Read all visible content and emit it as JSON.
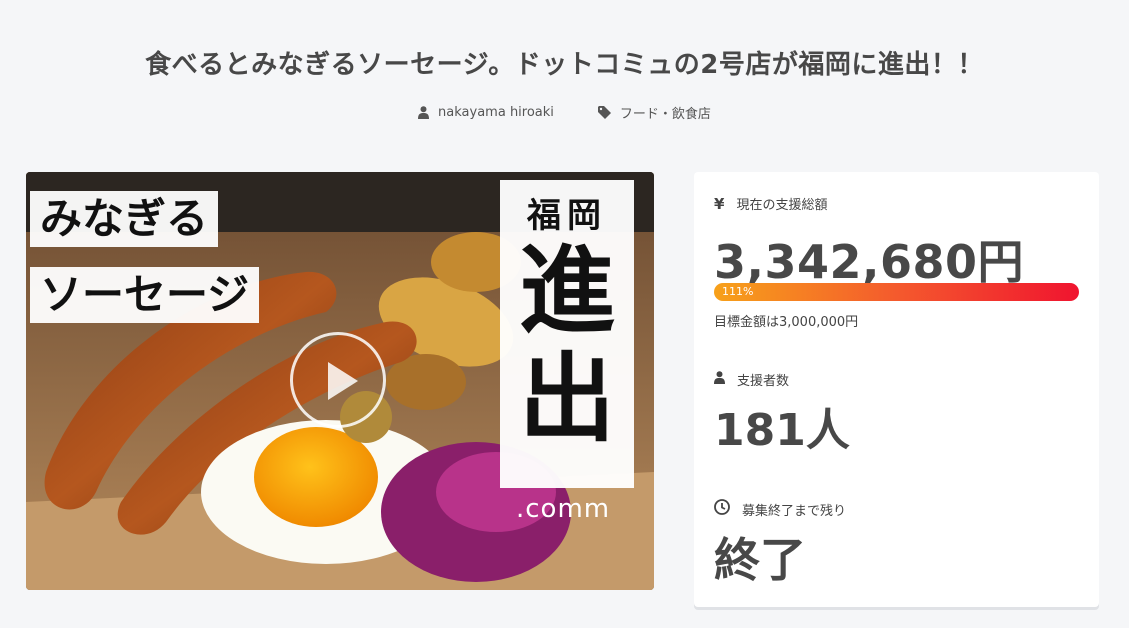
{
  "project": {
    "title": "食べるとみなぎるソーセージ。ドットコミュの2号店が福岡に進出！！",
    "author": "nakayama hiroaki",
    "category": "フード・飲食店"
  },
  "video": {
    "caption_line1": "みなぎる",
    "caption_line2": "ソーセージ",
    "vertical_small": "福岡",
    "vertical_big1": "進",
    "vertical_big2": "出",
    "brand": ".comm"
  },
  "stats": {
    "amount_label": "現在の支援総額",
    "amount": "3,342,680円",
    "progress_text": "111%",
    "progress_fraction": 1.0,
    "goal": "目標金額は3,000,000円",
    "backers_label": "支援者数",
    "backers": "181人",
    "remaining_label": "募集終了まで残り",
    "remaining": "終了",
    "yen_symbol": "¥"
  },
  "colors": {
    "progress_start": "#f7a11a",
    "progress_end": "#f0142f",
    "text": "#484848"
  },
  "icons": [
    "user-icon",
    "tag-icon",
    "yen-icon",
    "clock-icon",
    "play-icon"
  ]
}
